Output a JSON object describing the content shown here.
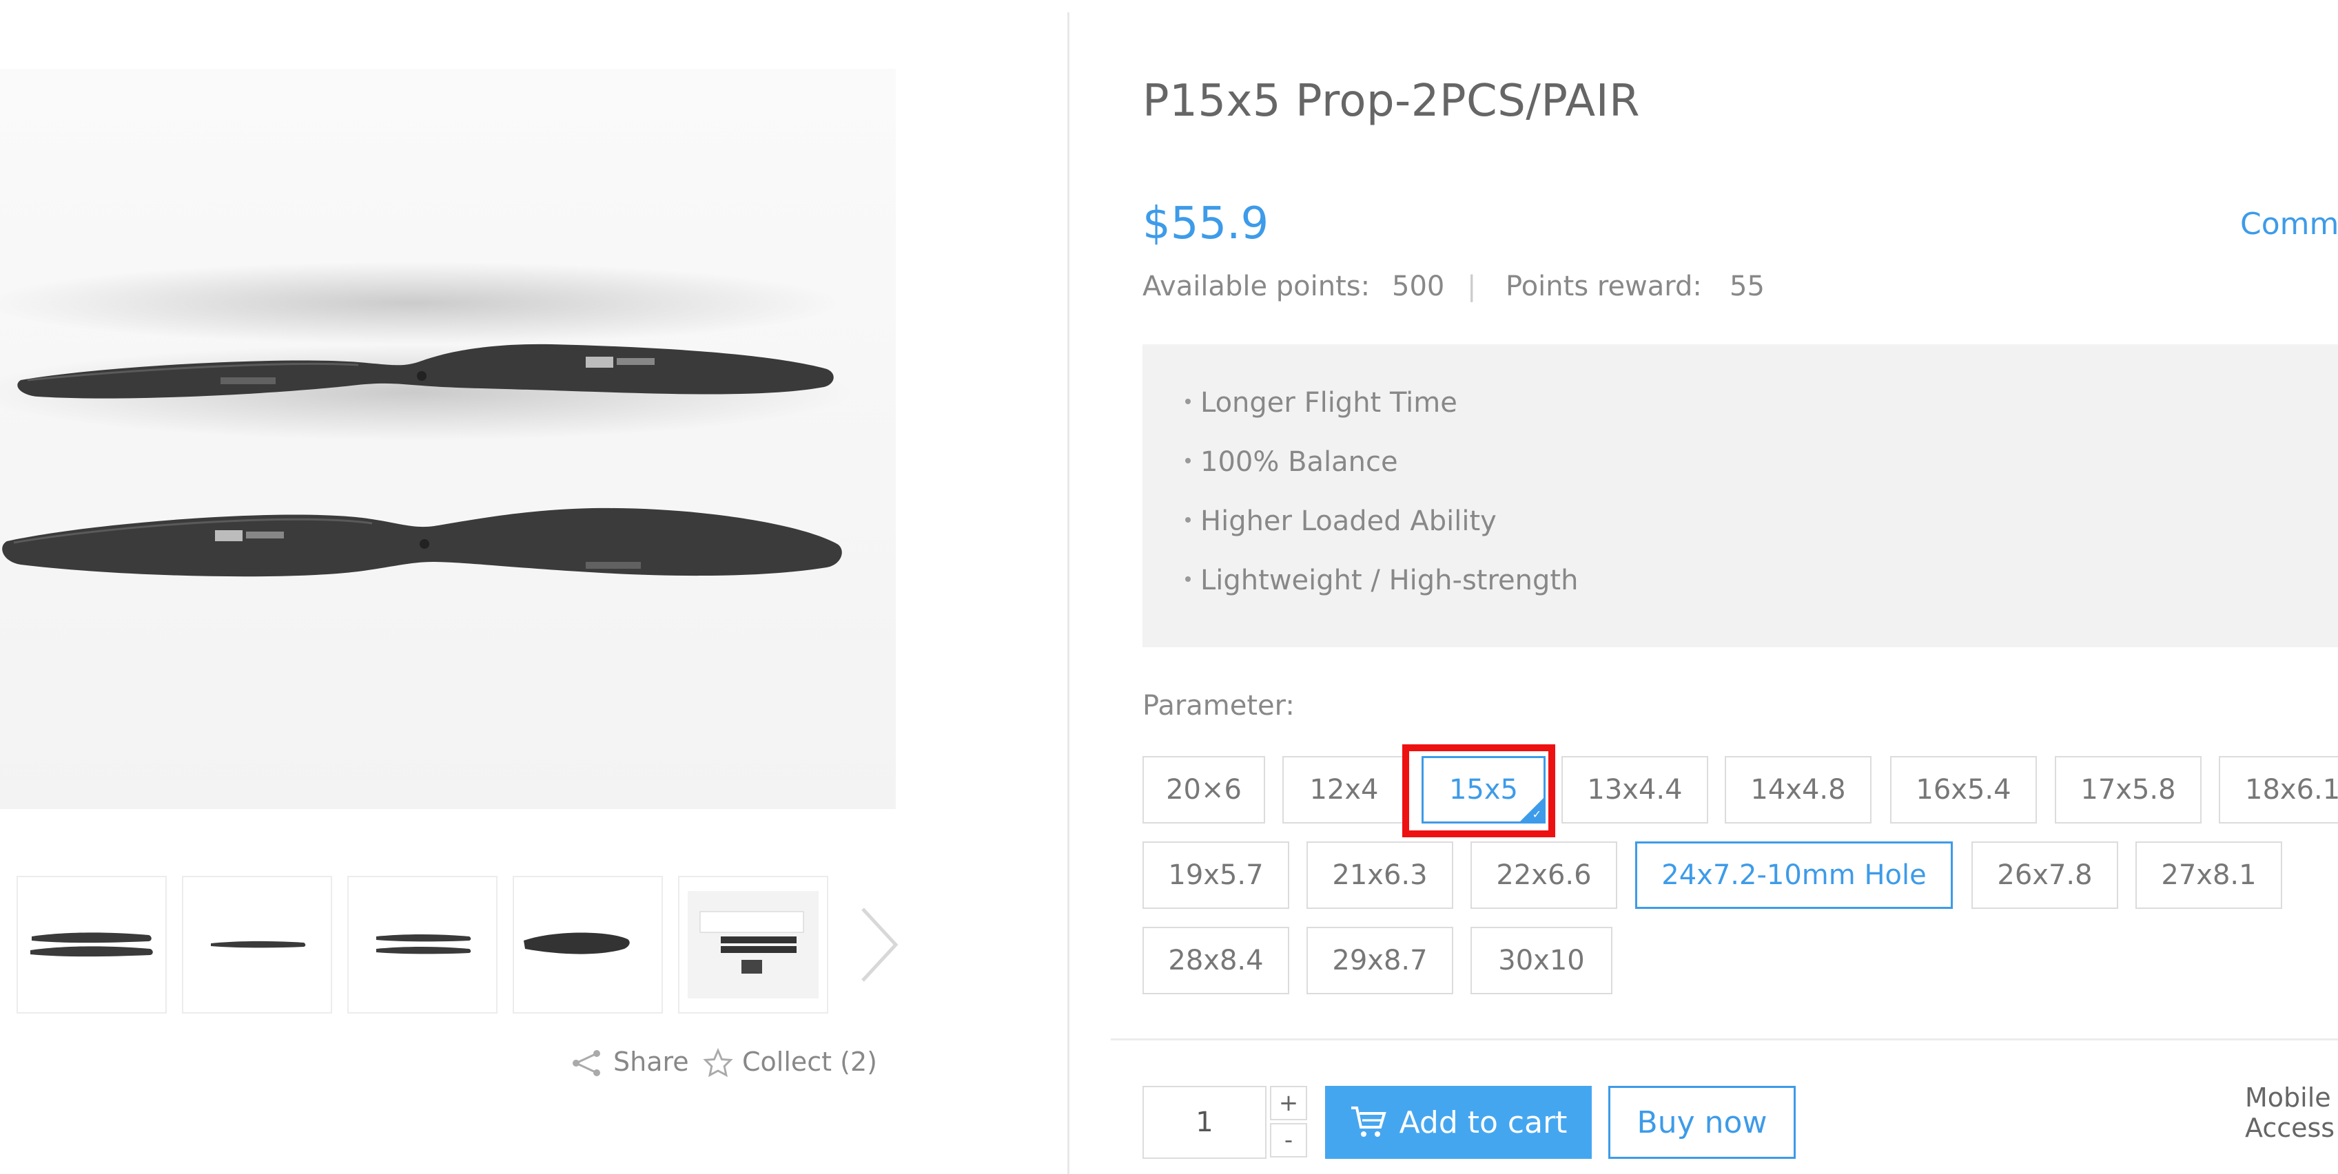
{
  "gallery": {
    "main_image_alt": "",
    "thumbnails": [
      "thumb-1",
      "thumb-2",
      "thumb-3",
      "thumb-4",
      "thumb-5"
    ],
    "share_label": "Share",
    "collect_label": "Collect (2)"
  },
  "product": {
    "title": "P15x5 Prop-2PCS/PAIR",
    "price": "$55.9",
    "comment_link": "Comme",
    "available_points_label": "Available points:",
    "available_points_value": "500",
    "points_separator": "|",
    "points_reward_label": "Points reward:",
    "points_reward_value": "55",
    "features": [
      "Longer Flight Time",
      "100% Balance",
      "Higher Loaded Ability",
      "Lightweight / High-strength"
    ],
    "parameter_label": "Parameter:",
    "options": [
      "20×6",
      "12x4",
      "15x5",
      "13x4.4",
      "14x4.8",
      "16x5.4",
      "17x5.8",
      "18x6.1",
      "19x5.7",
      "21x6.3",
      "22x6.6",
      "24x7.2-10mm Hole",
      "26x7.8",
      "27x8.1",
      "28x8.4",
      "29x8.7",
      "30x10"
    ],
    "selected_options": [
      "15x5",
      "24x7.2-10mm Hole"
    ]
  },
  "purchase": {
    "quantity": "1",
    "plus_label": "+",
    "minus_label": "-",
    "add_to_cart_label": "Add to cart",
    "buy_now_label": "Buy now",
    "mobile_access_line1": "Mobile",
    "mobile_access_line2": "Access"
  },
  "colors": {
    "accent": "#3d9be9",
    "button_fill": "#45a6f0",
    "highlight": "#e11111"
  }
}
